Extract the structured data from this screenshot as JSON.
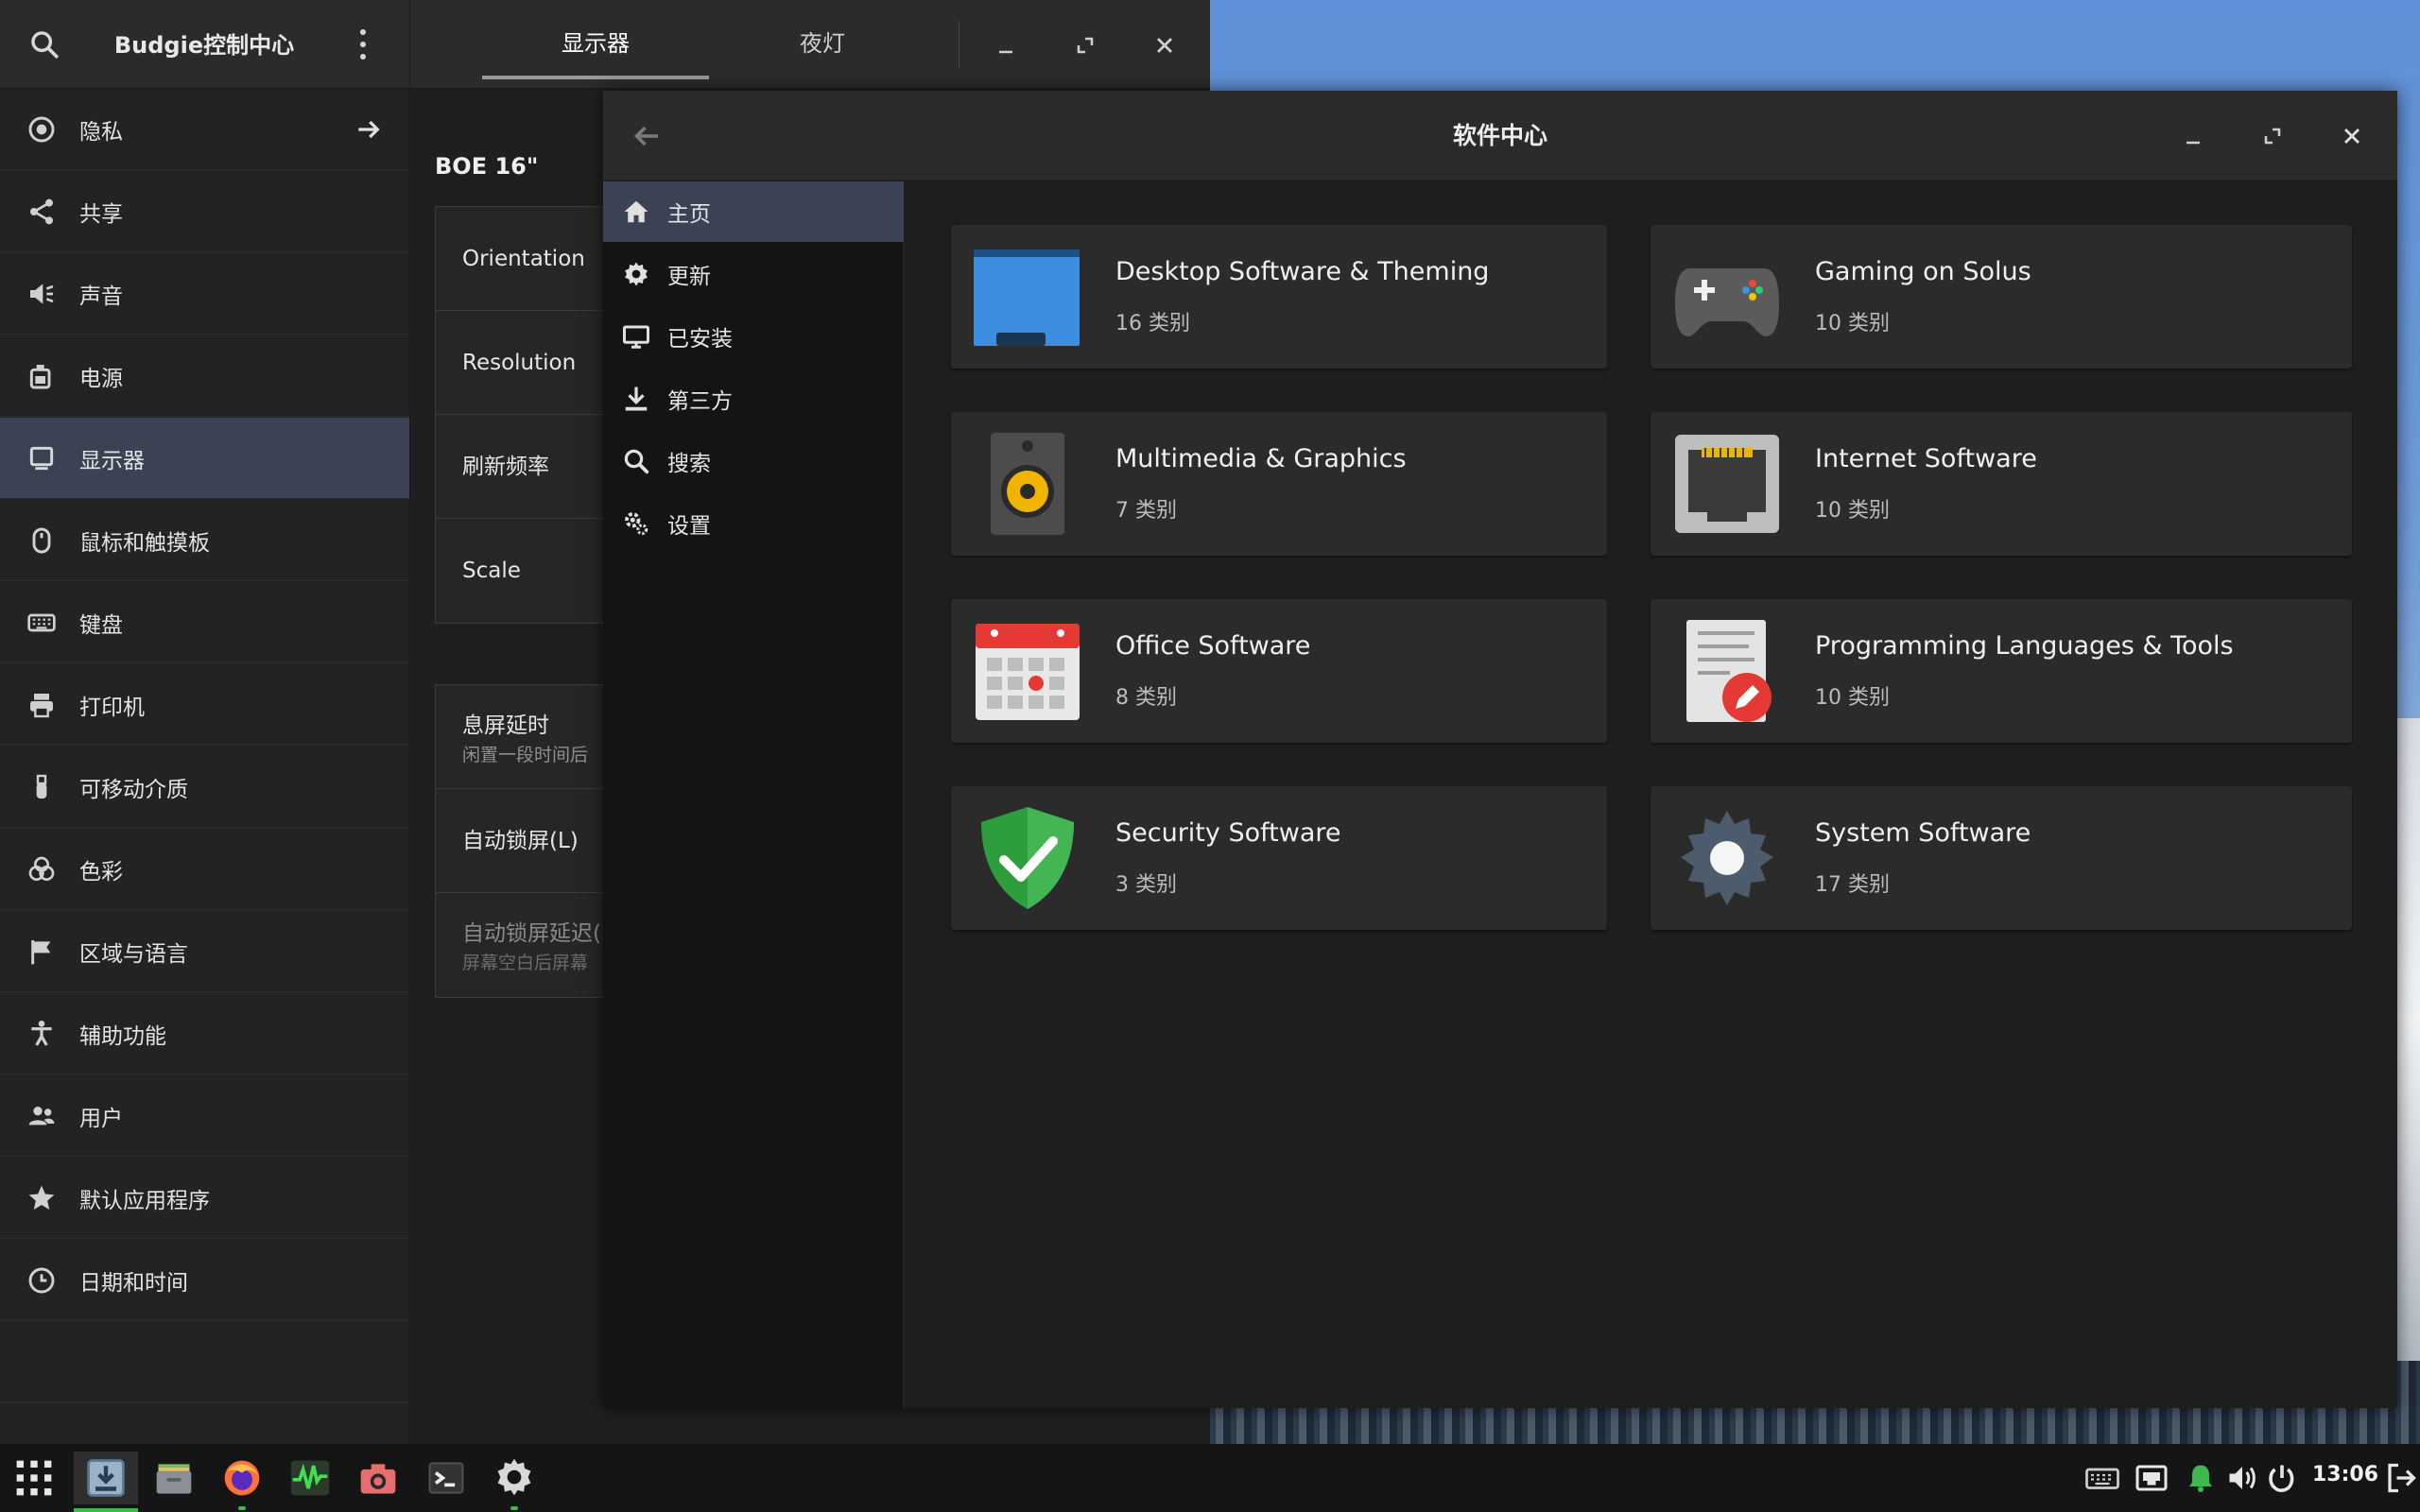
{
  "control_center": {
    "title": "Budgie控制中心",
    "tabs": [
      {
        "label": "显示器",
        "active": true
      },
      {
        "label": "夜灯",
        "active": false
      }
    ],
    "sidebar": [
      {
        "label": "隐私",
        "icon": "privacy-icon",
        "has_arrow": true
      },
      {
        "label": "共享",
        "icon": "share-icon"
      },
      {
        "label": "声音",
        "icon": "sound-icon"
      },
      {
        "label": "电源",
        "icon": "power-icon"
      },
      {
        "label": "显示器",
        "icon": "display-icon",
        "active": true
      },
      {
        "label": "鼠标和触摸板",
        "icon": "mouse-icon"
      },
      {
        "label": "键盘",
        "icon": "keyboard-icon"
      },
      {
        "label": "打印机",
        "icon": "printer-icon"
      },
      {
        "label": "可移动介质",
        "icon": "removable-media-icon"
      },
      {
        "label": "色彩",
        "icon": "color-icon"
      },
      {
        "label": "区域与语言",
        "icon": "flag-icon"
      },
      {
        "label": "辅助功能",
        "icon": "accessibility-icon"
      },
      {
        "label": "用户",
        "icon": "users-icon"
      },
      {
        "label": "默认应用程序",
        "icon": "star-icon"
      },
      {
        "label": "日期和时间",
        "icon": "clock-icon"
      }
    ],
    "display": {
      "monitor_name": "BOE 16\"",
      "settings": [
        {
          "label": "Orientation"
        },
        {
          "label": "Resolution"
        },
        {
          "label": "刷新频率"
        },
        {
          "label": "Scale"
        }
      ],
      "lock_settings": [
        {
          "label": "息屏延时",
          "sub": "闲置一段时间后"
        },
        {
          "label": "自动锁屏(L)",
          "sub": ""
        },
        {
          "label": "自动锁屏延迟(",
          "sub": "屏幕空白后屏幕"
        }
      ]
    }
  },
  "software_center": {
    "title": "软件中心",
    "nav": [
      {
        "label": "主页",
        "icon": "home-icon",
        "active": true
      },
      {
        "label": "更新",
        "icon": "update-gear-icon"
      },
      {
        "label": "已安装",
        "icon": "monitor-icon"
      },
      {
        "label": "第三方",
        "icon": "download-icon"
      },
      {
        "label": "搜索",
        "icon": "search-icon"
      },
      {
        "label": "设置",
        "icon": "settings-icon"
      }
    ],
    "categories": [
      {
        "name": "Desktop Software & Theming",
        "count": "16 类别",
        "icon": "desktop-theming-icon"
      },
      {
        "name": "Gaming on Solus",
        "count": "10 类别",
        "icon": "gamepad-icon"
      },
      {
        "name": "Multimedia & Graphics",
        "count": "7 类别",
        "icon": "speaker-icon"
      },
      {
        "name": "Internet Software",
        "count": "10 类别",
        "icon": "network-port-icon"
      },
      {
        "name": "Office Software",
        "count": "8 类别",
        "icon": "calendar-icon"
      },
      {
        "name": "Programming Languages & Tools",
        "count": "10 类别",
        "icon": "document-edit-icon"
      },
      {
        "name": "Security Software",
        "count": "3 类别",
        "icon": "shield-check-icon"
      },
      {
        "name": "System Software",
        "count": "17 类别",
        "icon": "system-gear-icon"
      }
    ]
  },
  "taskbar": {
    "apps": [
      "app-grid-icon",
      "software-center-icon",
      "files-icon",
      "firefox-icon",
      "system-monitor-icon",
      "screenshot-icon",
      "terminal-icon",
      "control-center-icon"
    ],
    "tray": [
      "keyboard-icon",
      "network-icon",
      "notification-icon",
      "volume-icon",
      "power-icon"
    ],
    "clock": "13:06"
  },
  "colors": {
    "accent_selected": "#3a4254",
    "running_indicator": "#3fb94f"
  }
}
